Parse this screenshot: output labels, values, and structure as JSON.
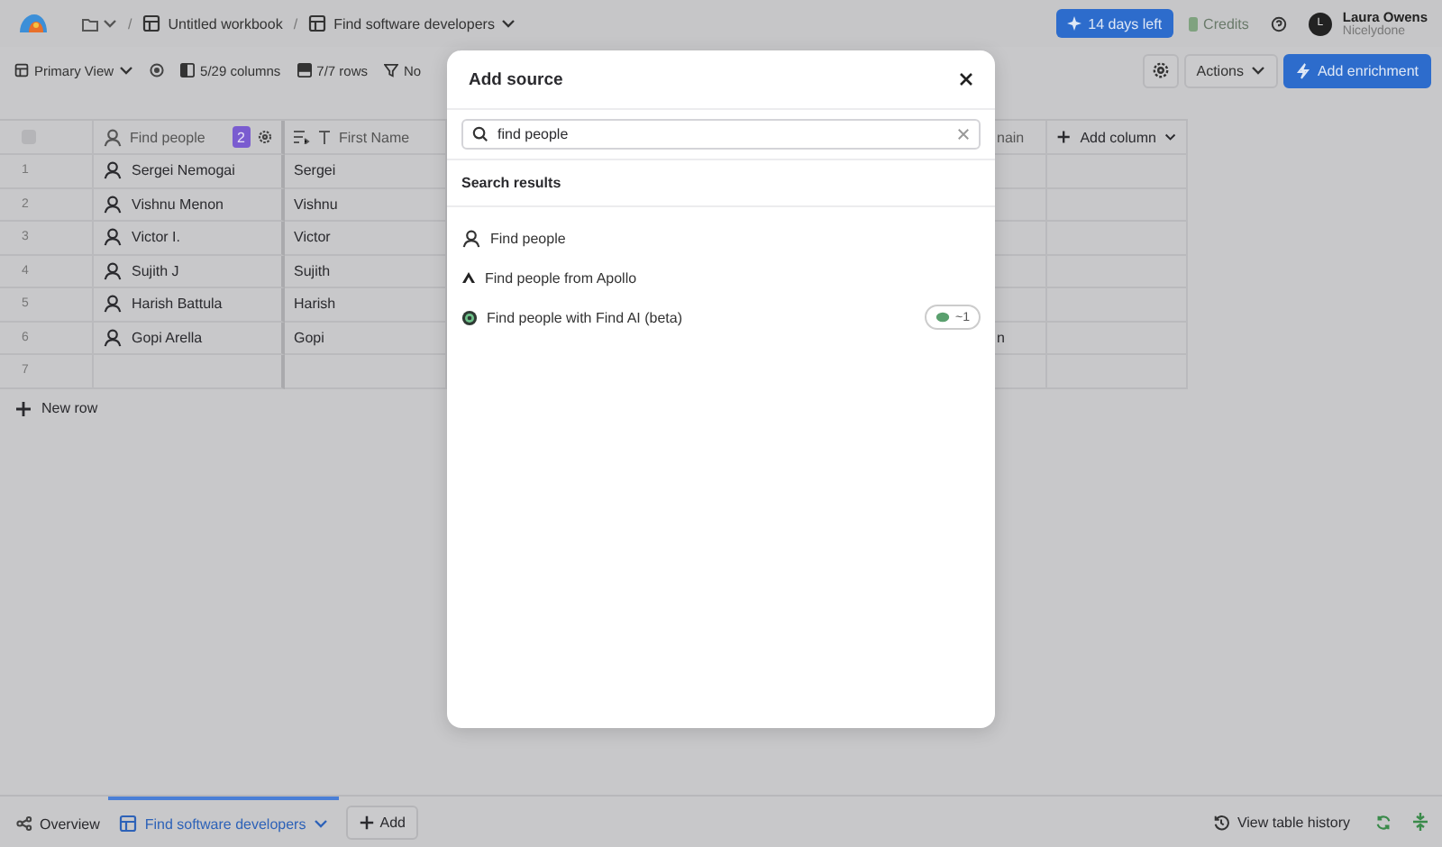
{
  "breadcrumb": {
    "separators": [
      "/",
      "/"
    ],
    "workbook": "Untitled workbook",
    "table": "Find software developers"
  },
  "header": {
    "trial": "14 days left",
    "credits": "Credits",
    "user_name": "Laura Owens",
    "user_org": "Nicelydone",
    "avatar": "L"
  },
  "toolbar": {
    "view": "Primary View",
    "columns": "5/29 columns",
    "rows": "7/7 rows",
    "filter": "No",
    "actions": "Actions",
    "add_enrichment": "Add enrichment"
  },
  "table": {
    "select_all": {
      "checked": false
    },
    "columns": [
      {
        "label": "Find people",
        "badge": "2"
      },
      {
        "label": "First Name"
      },
      {
        "label": "nain"
      },
      {
        "label": "Add column"
      }
    ],
    "rows": [
      {
        "number": "1",
        "name": "Sergei Nemogai",
        "first_name": "Sergei"
      },
      {
        "number": "2",
        "name": "Vishnu Menon",
        "first_name": "Vishnu"
      },
      {
        "number": "3",
        "name": "Victor I.",
        "first_name": "Victor"
      },
      {
        "number": "4",
        "name": "Sujith J",
        "first_name": "Sujith"
      },
      {
        "number": "5",
        "name": "Harish Battula",
        "first_name": "Harish"
      },
      {
        "number": "6",
        "name": "Gopi Arella",
        "first_name": "Gopi",
        "column_3": "n"
      },
      {
        "number": "7"
      }
    ],
    "new_row": "New row"
  },
  "modal": {
    "title": "Add source",
    "search": {
      "value": "find people"
    },
    "section": "Search results",
    "results": [
      {
        "label": "Find people",
        "kind": "person"
      },
      {
        "label": "Find people from Apollo",
        "kind": "apollo"
      },
      {
        "label": "Find people with Find AI (beta)",
        "kind": "ai",
        "cost": "~1"
      }
    ]
  },
  "bottom_bar": {
    "tabs": [
      {
        "label": "Overview",
        "kind": "overview",
        "selected": false
      },
      {
        "label": "Find software developers",
        "kind": "table",
        "selected": true
      }
    ],
    "add": "Add",
    "history": "View table history"
  }
}
